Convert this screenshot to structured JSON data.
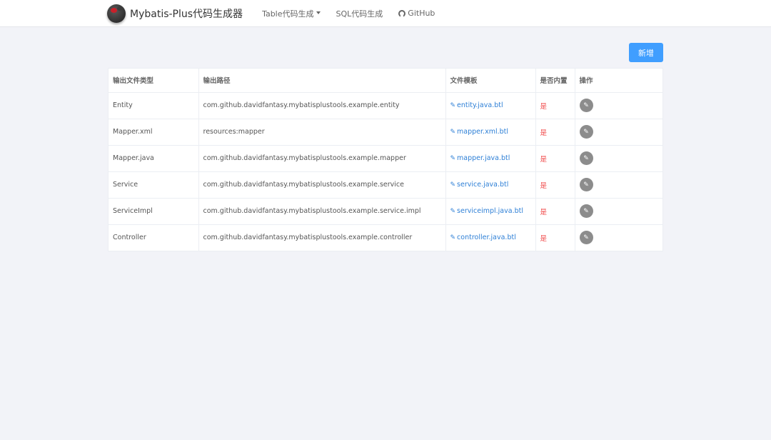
{
  "nav": {
    "brand": "Mybatis-Plus代码生成器",
    "items": [
      {
        "label": "Table代码生成"
      },
      {
        "label": "SQL代码生成"
      },
      {
        "label": "GitHub"
      }
    ]
  },
  "toolbar": {
    "add_label": "新增"
  },
  "table": {
    "headers": [
      "输出文件类型",
      "输出路径",
      "文件模板",
      "是否内置",
      "操作"
    ],
    "rows": [
      {
        "type": "Entity",
        "path": "com.github.davidfantasy.mybatisplustools.example.entity",
        "template": "entity.java.btl",
        "builtin": "是"
      },
      {
        "type": "Mapper.xml",
        "path": "resources:mapper",
        "template": "mapper.xml.btl",
        "builtin": "是"
      },
      {
        "type": "Mapper.java",
        "path": "com.github.davidfantasy.mybatisplustools.example.mapper",
        "template": "mapper.java.btl",
        "builtin": "是"
      },
      {
        "type": "Service",
        "path": "com.github.davidfantasy.mybatisplustools.example.service",
        "template": "service.java.btl",
        "builtin": "是"
      },
      {
        "type": "ServiceImpl",
        "path": "com.github.davidfantasy.mybatisplustools.example.service.impl",
        "template": "serviceimpl.java.btl",
        "builtin": "是"
      },
      {
        "type": "Controller",
        "path": "com.github.davidfantasy.mybatisplustools.example.controller",
        "template": "controller.java.btl",
        "builtin": "是"
      }
    ]
  },
  "colors": {
    "primary": "#409eff",
    "link": "#2d7fd6",
    "builtin": "#f04a4a",
    "background": "#f2f3f8"
  },
  "icons": {
    "logo": "mybatis-bird-logo",
    "dropdown": "caret-down-icon",
    "github": "github-icon",
    "template": "paperclip-icon",
    "edit": "pencil-icon"
  }
}
